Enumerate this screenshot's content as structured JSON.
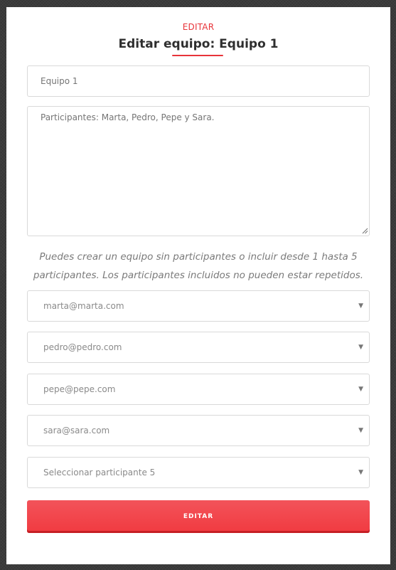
{
  "header": {
    "eyebrow": "EDITAR",
    "title": "Editar equipo: Equipo 1"
  },
  "form": {
    "team_name": {
      "placeholder": "Equipo 1"
    },
    "participants_note": {
      "placeholder": "Participantes: Marta, Pedro, Pepe y Sara."
    },
    "help_text": "Puedes crear un equipo sin participantes o incluir desde 1 hasta 5 participantes. Los participantes incluidos no pueden estar repetidos.",
    "selects": [
      {
        "value": "marta@marta.com"
      },
      {
        "value": "pedro@pedro.com"
      },
      {
        "value": "pepe@pepe.com"
      },
      {
        "value": "sara@sara.com"
      },
      {
        "value": "Seleccionar participante 5"
      }
    ],
    "submit_label": "EDITAR"
  },
  "icons": {
    "select_arrow": "chevron-down-icon",
    "resize_grip": "resize-grip-icon"
  },
  "colors": {
    "accent": "#e8343a",
    "button": "#f2474d",
    "background": "#3b3b3b"
  }
}
